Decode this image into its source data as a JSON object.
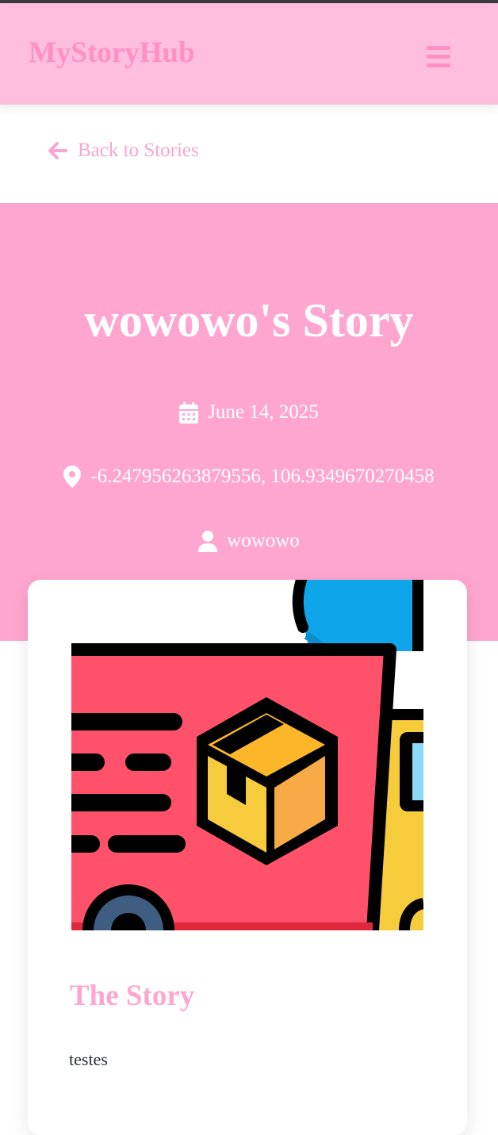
{
  "navbar": {
    "brand": "MyStoryHub",
    "menu_icon": "hamburger-menu-icon"
  },
  "back": {
    "label": "Back to Stories",
    "icon": "arrow-left-icon"
  },
  "story": {
    "title": "wowowo's Story",
    "date": "June 14, 2025",
    "date_icon": "calendar-icon",
    "location": "-6.247956263879556, 106.9349670270458",
    "location_icon": "map-pin-icon",
    "author": "wowowo",
    "author_icon": "user-icon",
    "image_icon": "delivery-truck-with-package-image",
    "section_title": "The Story",
    "body": "testes"
  },
  "colors": {
    "navbar_bg": "#ffbedd",
    "accent": "#ff8fc4",
    "hero_bg": "#ffa6d0",
    "link": "#f8a6cf"
  }
}
